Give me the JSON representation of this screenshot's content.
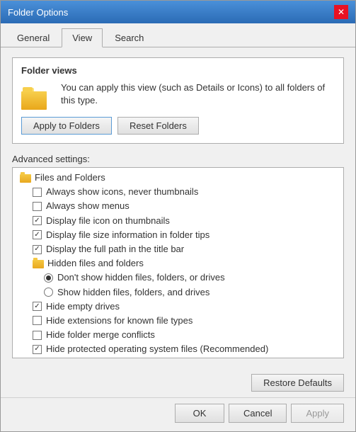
{
  "window": {
    "title": "Folder Options",
    "close_label": "✕"
  },
  "tabs": [
    {
      "label": "General",
      "active": false
    },
    {
      "label": "View",
      "active": true
    },
    {
      "label": "Search",
      "active": false
    }
  ],
  "folder_views": {
    "section_label": "Folder views",
    "description": "You can apply this view (such as Details or Icons) to all folders of this type.",
    "apply_btn": "Apply to Folders",
    "reset_btn": "Reset Folders"
  },
  "advanced": {
    "label": "Advanced settings:",
    "items": [
      {
        "type": "category",
        "text": "Files and Folders",
        "indent": 0
      },
      {
        "type": "checkbox",
        "checked": false,
        "text": "Always show icons, never thumbnails",
        "indent": 1
      },
      {
        "type": "checkbox",
        "checked": false,
        "text": "Always show menus",
        "indent": 1
      },
      {
        "type": "checkbox",
        "checked": true,
        "text": "Display file icon on thumbnails",
        "indent": 1
      },
      {
        "type": "checkbox",
        "checked": true,
        "text": "Display file size information in folder tips",
        "indent": 1
      },
      {
        "type": "checkbox",
        "checked": true,
        "text": "Display the full path in the title bar",
        "indent": 1
      },
      {
        "type": "category",
        "text": "Hidden files and folders",
        "indent": 1
      },
      {
        "type": "radio",
        "checked": true,
        "text": "Don't show hidden files, folders, or drives",
        "indent": 2
      },
      {
        "type": "radio",
        "checked": false,
        "text": "Show hidden files, folders, and drives",
        "indent": 2
      },
      {
        "type": "checkbox",
        "checked": true,
        "text": "Hide empty drives",
        "indent": 1
      },
      {
        "type": "checkbox",
        "checked": false,
        "text": "Hide extensions for known file types",
        "indent": 1
      },
      {
        "type": "checkbox",
        "checked": false,
        "text": "Hide folder merge conflicts",
        "indent": 1
      },
      {
        "type": "checkbox",
        "checked": true,
        "text": "Hide protected operating system files (Recommended)",
        "indent": 1
      }
    ],
    "restore_btn": "Restore Defaults"
  },
  "dialog_buttons": {
    "ok": "OK",
    "cancel": "Cancel",
    "apply": "Apply"
  }
}
